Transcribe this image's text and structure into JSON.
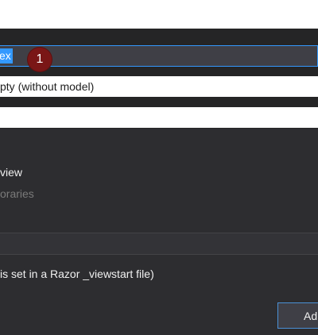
{
  "form": {
    "view_name_value": "ex",
    "callout_number": "1",
    "template_value": "pty (without model)",
    "model_class_value": "",
    "option_partial_view": "view",
    "option_reference_libraries": "oraries",
    "layout_value": "",
    "layout_hint": "is set in a Razor _viewstart file)"
  },
  "footer": {
    "add_label": "Ad"
  },
  "colors": {
    "selection": "#3399ff",
    "callout": "#7a1616",
    "accent_border": "#4b91d6"
  }
}
